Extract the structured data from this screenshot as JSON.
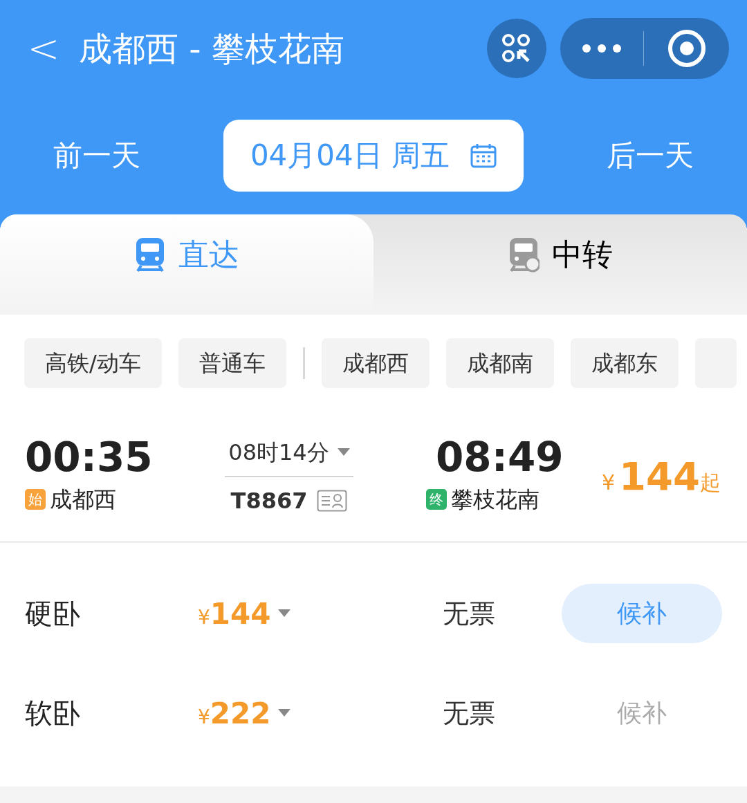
{
  "header": {
    "back": "<",
    "title": "成都西 - 攀枝花南"
  },
  "date_bar": {
    "prev": "前一天",
    "date": "04月04日 周五",
    "next": "后一天"
  },
  "tabs": [
    {
      "label": "直达",
      "selected": true
    },
    {
      "label": "中转",
      "selected": false
    }
  ],
  "filters": [
    {
      "label": "高铁/动车",
      "kind": "type"
    },
    {
      "label": "普通车",
      "kind": "type"
    },
    {
      "label": "成都西",
      "kind": "station"
    },
    {
      "label": "成都南",
      "kind": "station"
    },
    {
      "label": "成都东",
      "kind": "station"
    }
  ],
  "train": {
    "depart_time": "00:35",
    "depart_tag": "始",
    "depart_station": "成都西",
    "duration": "08时14分",
    "number": "T8867",
    "arrive_time": "08:49",
    "arrive_tag": "终",
    "arrive_station": "攀枝花南",
    "price_symbol": "¥",
    "price": "144",
    "price_suffix": "起"
  },
  "seats": [
    {
      "name": "硬卧",
      "currency": "¥",
      "price": "144",
      "availability": "无票",
      "waitlist": "候补",
      "disabled": false
    },
    {
      "name": "软卧",
      "currency": "¥",
      "price": "222",
      "availability": "无票",
      "waitlist": "候补",
      "disabled": true
    }
  ]
}
